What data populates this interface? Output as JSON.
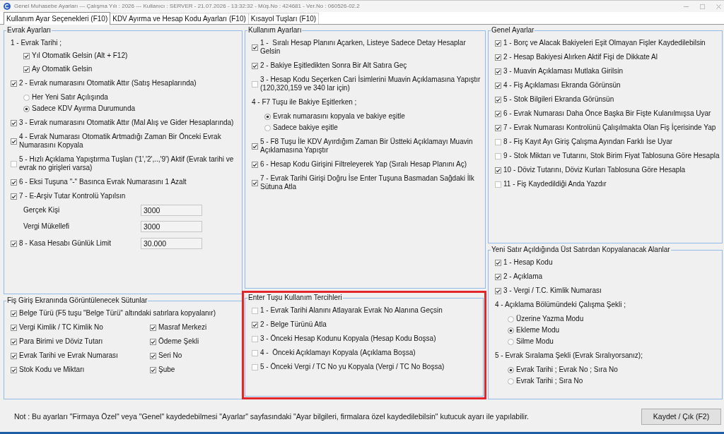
{
  "window": {
    "title": "Genel Muhasebe Ayarları --- Çalışma Yılı : 2026 --- Kullanıcı : SERVER - 21.07.2026 - 13:32:32 - Müş.No : 424681 - Ver.No : 060526-02.2"
  },
  "tabs": [
    {
      "label": "Kullanım Ayar Seçenekleri (F10)",
      "selected": true
    },
    {
      "label": "KDV Ayırma ve Hesap Kodu Ayarları (F10)",
      "selected": false
    },
    {
      "label": "Kısayol Tuşları (F10)",
      "selected": false
    }
  ],
  "columns": [
    {
      "groups": [
        {
          "title": "Evrak Ayarları",
          "highlighted": false,
          "items": [
            {
              "kind": "heading",
              "text": "1 - Evrak Tarihi ;",
              "children": [
                {
                  "kind": "checkbox",
                  "text": "Yıl Otomatik Gelsin (Alt + F12)",
                  "checked": true
                },
                {
                  "kind": "checkbox",
                  "text": "Ay Otomatik Gelsin",
                  "checked": true
                }
              ]
            },
            {
              "kind": "checkbox",
              "text": "2 - Evrak numarasını Otomatik Attır (Satış Hesaplarında)",
              "checked": true,
              "children": [
                {
                  "kind": "radio",
                  "text": "Her Yeni Satır Açılışında",
                  "selected": false
                },
                {
                  "kind": "radio",
                  "text": "Sadece KDV Ayırma Durumunda",
                  "selected": true
                }
              ]
            },
            {
              "kind": "checkbox",
              "text": "3 - Evrak numarasını Otomatik Attır (Mal Alış ve Gider Hesaplarında)",
              "checked": true
            },
            {
              "kind": "checkbox",
              "text": "4 - Evrak Numarası Otomatik Artmadığı Zaman Bir Önceki Evrak Numarasını Kopyala",
              "checked": true
            },
            {
              "kind": "checkbox",
              "text": "5 - Hızlı Açıklama Yapıştırma Tuşları ('1','2',..,'9') Aktif (Evrak tarihi ve evrak no girişleri varsa)",
              "checked": false
            },
            {
              "kind": "checkbox",
              "text": "6 - Eksi Tuşuna \"-\" Basınca Evrak Numarasını 1 Azalt",
              "checked": true
            },
            {
              "kind": "checkbox",
              "text": "7 - E-Arşiv Tutar Kontrolü Yapılsın",
              "checked": true,
              "children": [
                {
                  "kind": "field",
                  "label": "Gerçek Kişi",
                  "value": "3000"
                },
                {
                  "kind": "field",
                  "label": "Vergi Mükellefi",
                  "value": "3000"
                }
              ]
            },
            {
              "kind": "checkbox_field",
              "text": "8 - Kasa Hesabı Günlük Limit",
              "checked": true,
              "value": "30.000"
            }
          ]
        },
        {
          "title": "Fiş Giriş Ekranında Görüntülenecek Sütunlar",
          "highlighted": false,
          "items": [
            {
              "kind": "checkbox",
              "text": "Belge Türü (F5 tuşu \"Belge Türü\" altındaki satırlara kopyalanır)",
              "checked": true
            }
          ],
          "two_column_items": [
            {
              "kind": "checkbox",
              "text": "Vergi Kimlik / TC Kimlik No",
              "checked": true
            },
            {
              "kind": "checkbox",
              "text": "Masraf Merkezi",
              "checked": true
            },
            {
              "kind": "checkbox",
              "text": "Para Birimi ve Döviz Tutarı",
              "checked": true
            },
            {
              "kind": "checkbox",
              "text": "Ödeme Şekli",
              "checked": true
            },
            {
              "kind": "checkbox",
              "text": "Evrak Tarihi ve Evrak Numarası",
              "checked": true
            },
            {
              "kind": "checkbox",
              "text": "Seri No",
              "checked": true
            },
            {
              "kind": "checkbox",
              "text": "Stok Kodu ve Miktarı",
              "checked": true
            },
            {
              "kind": "checkbox",
              "text": "Şube",
              "checked": true
            }
          ]
        }
      ]
    },
    {
      "groups": [
        {
          "title": "Kullanım Ayarları",
          "highlighted": false,
          "items": [
            {
              "kind": "checkbox",
              "text": "1 -  Sıralı Hesap Planını Açarken, Listeye Sadece Detay Hesaplar Gelsin",
              "checked": true
            },
            {
              "kind": "checkbox",
              "text": "2 - Bakiye Eşitledikten Sonra Bir Alt Satıra Geç",
              "checked": true
            },
            {
              "kind": "checkbox",
              "text": "3 - Hesap Kodu Seçerken Cari İsimlerini Muavin Açıklamasına Yapıştır (120,320,159 ve 340 lar için)",
              "checked": false
            },
            {
              "kind": "heading",
              "text": "4 - F7 Tuşu ile Bakiye Eşitlerken ;",
              "children": [
                {
                  "kind": "radio",
                  "text": "Evrak numarasını kopyala ve bakiye eşitle",
                  "selected": true
                },
                {
                  "kind": "radio",
                  "text": "Sadece bakiye eşitle",
                  "selected": false
                }
              ]
            },
            {
              "kind": "checkbox",
              "text": "5 - F8 Tuşu İle KDV Ayırdığım Zaman Bir Üstteki Açıklamayı Muavin Açıklamasına Yapıştır",
              "checked": true
            },
            {
              "kind": "checkbox",
              "text": "6 - Hesap Kodu Girişini Filtreleyerek Yap (Sıralı Hesap Planını Aç)",
              "checked": true
            },
            {
              "kind": "checkbox",
              "text": "7 - Evrak Tarihi Girişi Doğru İse Enter Tuşuna Basmadan Sağdaki İlk Sütuna Atla",
              "checked": true
            }
          ]
        },
        {
          "title": "Enter Tuşu Kullanım Tercihleri",
          "highlighted": true,
          "items": [
            {
              "kind": "checkbox",
              "text": "1 - Evrak Tarihi Alanını Atlayarak Evrak No Alanına Geçsin",
              "checked": false
            },
            {
              "kind": "checkbox",
              "text": "2 - Belge Türünü Atla",
              "checked": true
            },
            {
              "kind": "checkbox",
              "text": "3 - Önceki Hesap Kodunu Kopyala (Hesap Kodu Boşsa)",
              "checked": false
            },
            {
              "kind": "checkbox",
              "text": "4 -  Önceki Açıklamayı Kopyala (Açıklama Boşsa)",
              "checked": false
            },
            {
              "kind": "checkbox",
              "text": "5 - Önceki Vergi / TC No yu Kopyala (Vergi / TC No Boşsa)",
              "checked": false
            }
          ]
        }
      ]
    },
    {
      "groups": [
        {
          "title": "Genel Ayarlar",
          "highlighted": false,
          "items": [
            {
              "kind": "checkbox",
              "text": "1 - Borç ve Alacak Bakiyeleri Eşit Olmayan Fişler Kaydedilebilsin",
              "checked": true
            },
            {
              "kind": "checkbox",
              "text": "2 - Hesap Bakiyesi Alırken Aktif Fişi de Dikkate Al",
              "checked": true
            },
            {
              "kind": "checkbox",
              "text": "3 - Muavin Açıklaması Mutlaka Girilsin",
              "checked": true
            },
            {
              "kind": "checkbox",
              "text": "4 - Fiş Açıklaması Ekranda Görünsün",
              "checked": true
            },
            {
              "kind": "checkbox",
              "text": "5 - Stok Bilgileri Ekranda Görünsün",
              "checked": true
            },
            {
              "kind": "checkbox",
              "text": "6 - Evrak Numarası Daha Önce Başka Bir Fişte Kulanılmışsa Uyar",
              "checked": true
            },
            {
              "kind": "checkbox",
              "text": "7 - Evrak Numarası Kontrolünü Çalışılmakta Olan Fiş İçerisinde Yap",
              "checked": true
            },
            {
              "kind": "checkbox",
              "text": "8 - Fiş Kayıt Ayı Giriş Çalışma Ayından Farklı İse Uyar",
              "checked": false
            },
            {
              "kind": "checkbox",
              "text": "9 - Stok Miktarı ve Tutarını, Stok Birim Fiyat Tablosuna Göre Hesapla",
              "checked": false
            },
            {
              "kind": "checkbox",
              "text": "10 - Döviz Tutarını, Döviz Kurları Tablosuna Göre Hesapla",
              "checked": true
            },
            {
              "kind": "checkbox",
              "text": "11 - Fiş Kaydedildiği Anda Yazdır",
              "checked": false
            }
          ]
        },
        {
          "title": "Yeni Satır Açıldığında Üst Satırdan Kopyalanacak Alanlar",
          "highlighted": false,
          "items": [
            {
              "kind": "checkbox",
              "text": "1 - Hesap Kodu",
              "checked": true
            },
            {
              "kind": "checkbox",
              "text": "2 - Açıklama",
              "checked": true
            },
            {
              "kind": "checkbox",
              "text": "3 - Vergi / T.C. Kimlik Numarası",
              "checked": true
            },
            {
              "kind": "heading",
              "text": "4 - Açıklama Bölümündeki Çalışma Şekli ;",
              "children": [
                {
                  "kind": "radio",
                  "text": "Üzerine Yazma Modu",
                  "selected": false
                },
                {
                  "kind": "radio",
                  "text": "Ekleme Modu",
                  "selected": true
                },
                {
                  "kind": "radio",
                  "text": "Silme Modu",
                  "selected": false
                }
              ]
            },
            {
              "kind": "heading",
              "text": "5 - Evrak Sıralama Şekli (Evrak Sıralıyorsanız);",
              "children": [
                {
                  "kind": "radio",
                  "text": "Evrak Tarihi ; Evrak No ; Sıra No",
                  "selected": true
                },
                {
                  "kind": "radio",
                  "text": "Evrak Tarihi ; Sıra No",
                  "selected": false
                }
              ]
            }
          ]
        }
      ]
    }
  ],
  "footer": {
    "note": "Not : Bu ayarları \"Firmaya Özel\" veya \"Genel\" kaydedebilmesi \"Ayarlar\" sayfasındaki \"Ayar bilgileri, firmalara özel kaydedilebilsin\" kutucuk ayarı ile yapılabilir.",
    "button": "Kaydet / Çık (F2)"
  }
}
